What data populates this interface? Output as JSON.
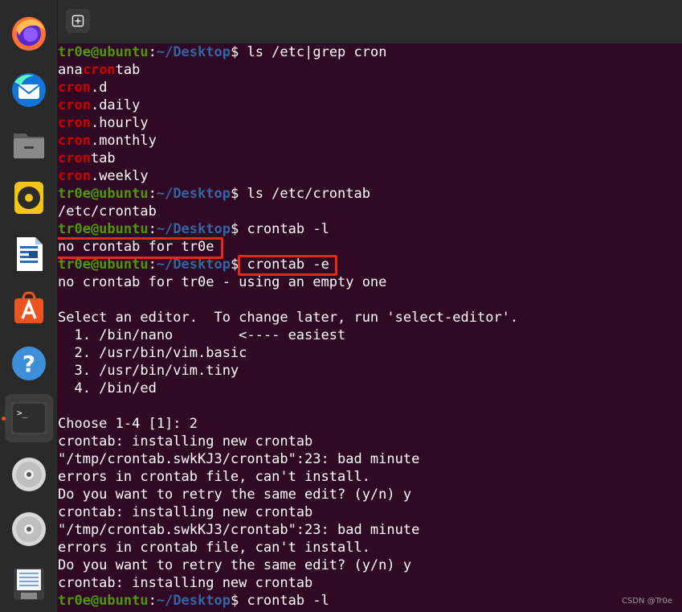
{
  "dock": {
    "items": [
      {
        "name": "Firefox",
        "icon": "firefox-icon"
      },
      {
        "name": "Thunderbird",
        "icon": "thunderbird-icon"
      },
      {
        "name": "Files",
        "icon": "files-icon"
      },
      {
        "name": "Rhythmbox",
        "icon": "rhythmbox-icon"
      },
      {
        "name": "LibreOffice Writer",
        "icon": "writer-icon"
      },
      {
        "name": "Ubuntu Software",
        "icon": "software-icon"
      },
      {
        "name": "Help",
        "icon": "help-icon"
      },
      {
        "name": "Terminal",
        "icon": "terminal-icon",
        "active": true
      },
      {
        "name": "Disc",
        "icon": "disc-icon"
      },
      {
        "name": "Disc",
        "icon": "disc-icon"
      },
      {
        "name": "Disk image",
        "icon": "floppy-icon"
      }
    ],
    "help_glyph": "?",
    "terminal_glyph": ">_"
  },
  "terminal": {
    "newtab_glyph": "+",
    "prompt_user": "tr0e@ubuntu",
    "prompt_sep": ":",
    "prompt_path": "~/Desktop",
    "prompt_end": "$ ",
    "commands": {
      "c1": "ls /etc|grep cron",
      "c2": "ls /etc/crontab",
      "c3": "crontab -l",
      "c4": "crontab -e",
      "c5": "crontab -l"
    },
    "grep": {
      "l1a": "ana",
      "l1b": "cron",
      "l1c": "tab",
      "l2a": "cron",
      "l2b": ".d",
      "l3a": "cron",
      "l3b": ".daily",
      "l4a": "cron",
      "l4b": ".hourly",
      "l5a": "cron",
      "l5b": ".monthly",
      "l6a": "cron",
      "l6b": "tab",
      "l7a": "cron",
      "l7b": ".weekly"
    },
    "out": {
      "o1": "/etc/crontab",
      "o2": "no crontab for tr0e",
      "o3": "no crontab for tr0e - using an empty one",
      "o4": "Select an editor.  To change later, run 'select-editor'.",
      "o5": "  1. /bin/nano        <---- easiest",
      "o6": "  2. /usr/bin/vim.basic",
      "o7": "  3. /usr/bin/vim.tiny",
      "o8": "  4. /bin/ed",
      "o9": "Choose 1-4 [1]: 2",
      "o10": "crontab: installing new crontab",
      "o11": "\"/tmp/crontab.swkKJ3/crontab\":23: bad minute",
      "o12": "errors in crontab file, can't install.",
      "o13": "Do you want to retry the same edit? (y/n) y",
      "o14": "crontab: installing new crontab",
      "o15": "\"/tmp/crontab.swkKJ3/crontab\":23: bad minute",
      "o16": "errors in crontab file, can't install.",
      "o17": "Do you want to retry the same edit? (y/n) y",
      "o18": "crontab: installing new crontab"
    }
  },
  "watermark": "CSDN @Tr0e",
  "colors": {
    "background": "#300a24",
    "prompt_user": "#4e9a06",
    "prompt_path": "#3465a4",
    "grep_match": "#cc0000",
    "highlight_box": "#e8261c"
  }
}
